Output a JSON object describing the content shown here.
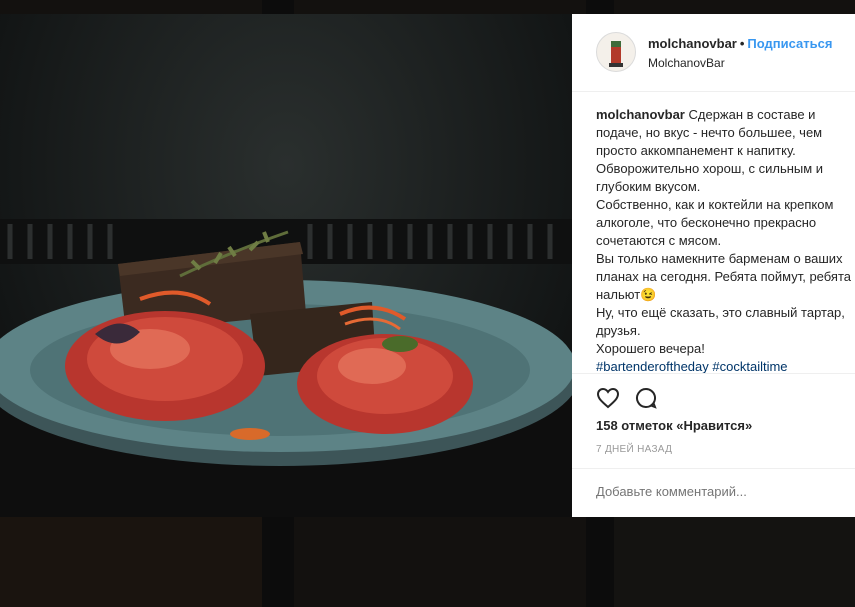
{
  "post": {
    "username": "molchanovbar",
    "follow_label": "Подписаться",
    "location": "MolchanovBar"
  },
  "caption": {
    "username": "molchanovbar",
    "lines": [
      "Сдержан в составе и",
      "подаче, но вкус - нечто большее, чем",
      "просто аккомпанемент к напитку.",
      "Обворожительно хорош, с сильным и",
      "глубоким вкусом.",
      "Собственно, как и коктейли на крепком",
      "алкоголе, что бесконечно прекрасно",
      "сочетаются с мясом.",
      "Вы только намекните барменам о ваших",
      "планах на сегодня. Ребята поймут, ребята",
      "нальют😉",
      "Ну, что ещё сказать, это славный тартар,",
      "друзья.",
      "Хорошего вечера!"
    ],
    "hashtags": [
      "#bartenderoftheday",
      "#cocktailtime"
    ]
  },
  "actions": {
    "like_icon": "heart-icon",
    "comment_icon": "comment-bubble-icon"
  },
  "likes": "158 отметок «Нравится»",
  "date": "7 ДНЕЙ НАЗАД",
  "comment": {
    "placeholder": "Добавьте комментарий..."
  },
  "colors": {
    "follow": "#3897f0",
    "hashtag": "#003569",
    "plate": "#5d8386"
  }
}
